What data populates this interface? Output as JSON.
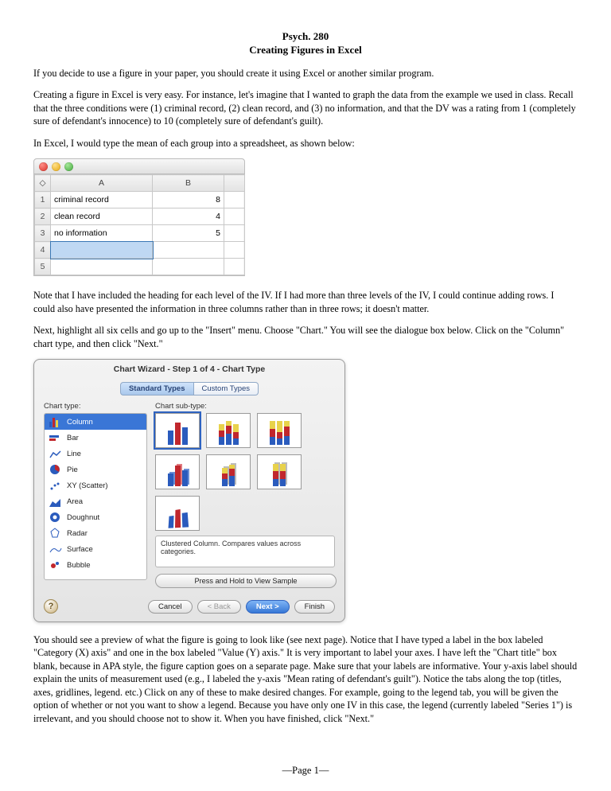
{
  "header": {
    "course": "Psych. 280",
    "title": "Creating Figures in Excel"
  },
  "paragraphs": {
    "p1": "If you decide to use a figure in your paper, you should create it using Excel or another similar program.",
    "p2": "Creating a figure in Excel is very easy. For instance, let's imagine that I wanted to graph the data from the example we used in class. Recall that the three conditions were (1) criminal record, (2) clean record, and (3) no information, and that the DV was a rating from 1 (completely sure of defendant's innocence) to 10 (completely sure of defendant's guilt).",
    "p3": "In Excel, I would type the mean of each group into a spreadsheet, as shown below:",
    "p4": "Note that I have included the heading for each level of the IV. If I had more than three levels of the IV, I could continue adding rows. I could also have presented the information in three columns rather than in three rows; it doesn't matter.",
    "p5": "Next, highlight all six cells and go up to the \"Insert\" menu. Choose \"Chart.\" You will see the dialogue box below.  Click on the \"Column\" chart type, and then click \"Next.\"",
    "p6": "You should see a preview of what the figure is going to look like (see next page). Notice that I have typed a label in the box labeled \"Category (X) axis\" and one in the box labeled \"Value (Y) axis.\" It is very important to label your axes. I have left the \"Chart title\" box blank, because in APA style, the figure caption goes on a separate page. Make sure that your labels are informative. Your y-axis label should explain the units of measurement used (e.g., I labeled the y-axis \"Mean rating of defendant's guilt\").  Notice the tabs along the top (titles, axes, gridlines, legend. etc.) Click on any of these to make desired changes. For example, going to the legend tab, you will be given the option of whether or not you want to show a legend. Because you  have only one IV in this case, the legend (currently labeled \"Series 1\") is irrelevant, and you should choose not to show it. When you have finished, click \"Next.\""
  },
  "spreadsheet": {
    "columns": [
      "A",
      "B"
    ],
    "rows": [
      {
        "n": "1",
        "a": "criminal record",
        "b": "8"
      },
      {
        "n": "2",
        "a": "clean record",
        "b": "4"
      },
      {
        "n": "3",
        "a": "no information",
        "b": "5"
      },
      {
        "n": "4",
        "a": "",
        "b": ""
      },
      {
        "n": "5",
        "a": "",
        "b": ""
      }
    ]
  },
  "wizard": {
    "title": "Chart Wizard - Step 1 of 4 - Chart Type",
    "tabs": {
      "standard": "Standard Types",
      "custom": "Custom Types"
    },
    "labels": {
      "type": "Chart type:",
      "subtype": "Chart sub-type:"
    },
    "types": [
      "Column",
      "Bar",
      "Line",
      "Pie",
      "XY (Scatter)",
      "Area",
      "Doughnut",
      "Radar",
      "Surface",
      "Bubble"
    ],
    "description": "Clustered Column. Compares values across categories.",
    "sample_btn": "Press and Hold to View Sample",
    "buttons": {
      "cancel": "Cancel",
      "back": "< Back",
      "next": "Next >",
      "finish": "Finish"
    }
  },
  "footer": "—Page 1—",
  "chart_data": {
    "type": "bar",
    "categories": [
      "criminal record",
      "clean record",
      "no information"
    ],
    "values": [
      8,
      4,
      5
    ],
    "title": "",
    "xlabel": "Category (X) axis",
    "ylabel": "Mean rating of defendant's guilt",
    "ylim": [
      1,
      10
    ]
  }
}
